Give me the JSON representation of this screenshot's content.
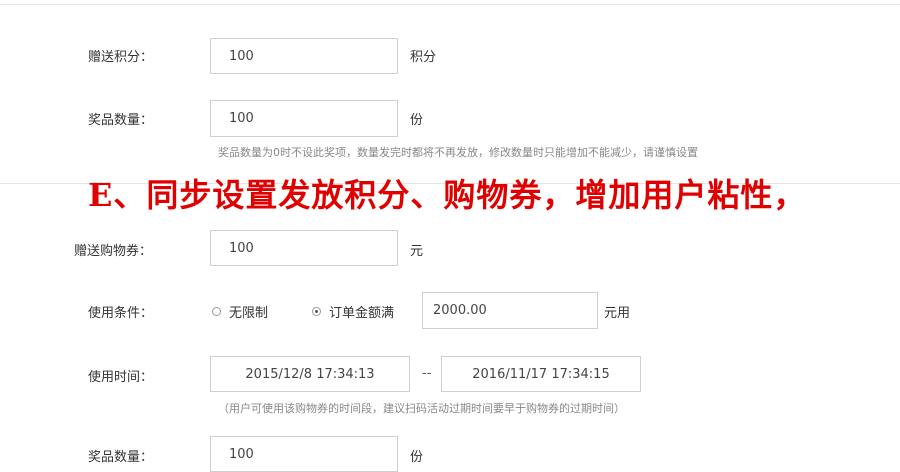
{
  "section1": {
    "points": {
      "label": "赠送积分：",
      "value": "100",
      "unit": "积分"
    },
    "prize_qty": {
      "label": "奖品数量：",
      "value": "100",
      "unit": "份"
    },
    "hint": "奖品数量为0时不设此奖项，数量发完时都将不再发放，修改数量时只能增加不能减少，请谨慎设置"
  },
  "annotation": "E、同步设置发放积分、购物券，增加用户粘性，",
  "section2": {
    "coupon": {
      "label": "赠送购物券：",
      "value": "100",
      "unit": "元"
    },
    "condition": {
      "label": "使用条件：",
      "option_unlimited": "无限制",
      "option_min_order": "订单金额满",
      "selected": "option_min_order",
      "amount": "2000.00",
      "unit": "元用"
    },
    "time": {
      "label": "使用时间：",
      "start": "2015/12/8 17:34:13",
      "separator": "--",
      "end": "2016/11/17 17:34:15",
      "hint": "（用户可使用该购物券的时间段，建议扫码活动过期时间要早于购物券的过期时间）"
    },
    "prize_qty": {
      "label": "奖品数量：",
      "value": "100",
      "unit": "份"
    }
  },
  "colors": {
    "annotation": "#e00000",
    "border": "#cfcfcf",
    "hint": "#888888"
  }
}
